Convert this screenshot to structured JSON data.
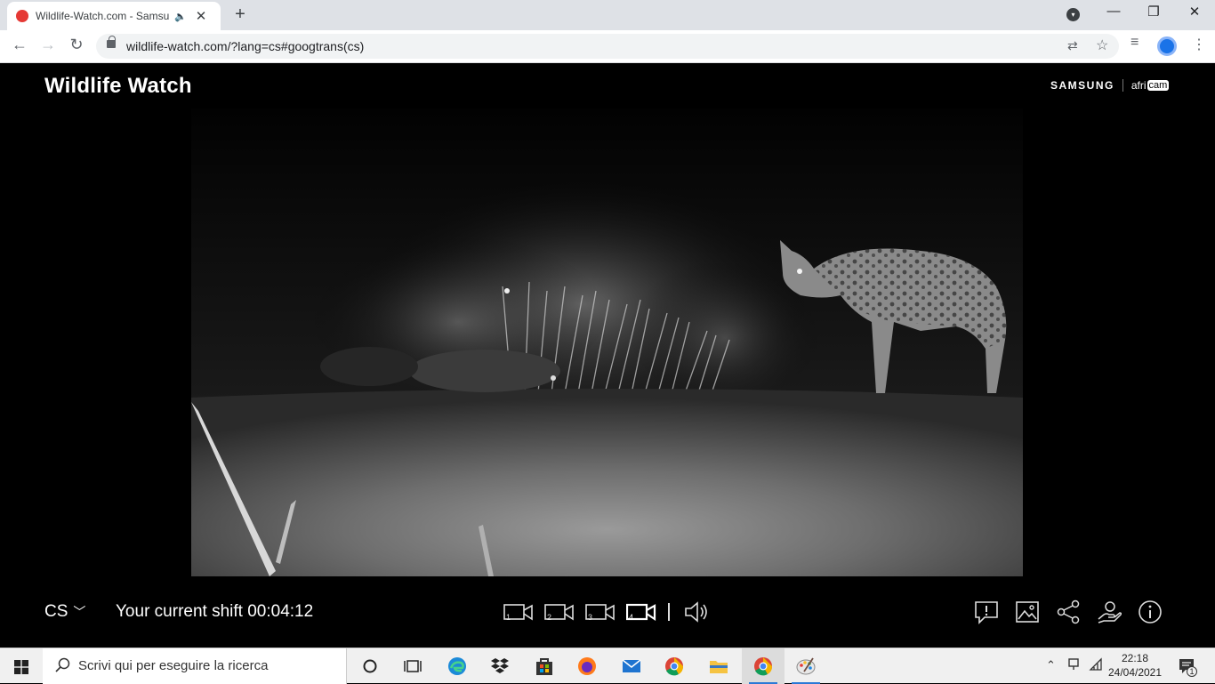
{
  "browser": {
    "tab_title": "Wildlife-Watch.com - Samsung",
    "speaker_icon": "🔈",
    "close_icon": "✕",
    "new_tab_icon": "+",
    "minimize_icon": "—",
    "restore_icon": "❐",
    "window_close_icon": "✕",
    "back_icon": "←",
    "forward_icon": "→",
    "reload_icon": "↻",
    "url": "wildlife-watch.com/?lang=cs#googtrans(cs)",
    "translate_icon": "⇄",
    "bookmark_icon": "☆",
    "reading_list_icon": "≡",
    "menu_icon": "⋮"
  },
  "site": {
    "title": "Wildlife Watch",
    "brand_primary": "SAMSUNG",
    "brand_secondary": "afri",
    "brand_secondary_highlight": "cam"
  },
  "controls": {
    "language": "CS",
    "language_chevron": "﹀",
    "shift_label": "Your current shift",
    "shift_time": "00:04:12",
    "cameras": [
      "1",
      "2",
      "3",
      "4"
    ],
    "selected_camera": "4"
  },
  "taskbar": {
    "search_placeholder": "Scrivi qui per eseguire la ricerca",
    "time": "22:18",
    "date": "24/04/2021",
    "tray_up_icon": "⌃",
    "notification_count": "1"
  },
  "colors": {
    "page_bg": "#000000",
    "tab_strip": "#dee1e6",
    "recording_dot": "#e53935",
    "taskbar_bg": "#f0f0f0",
    "accent_blue": "#2b79d6"
  }
}
